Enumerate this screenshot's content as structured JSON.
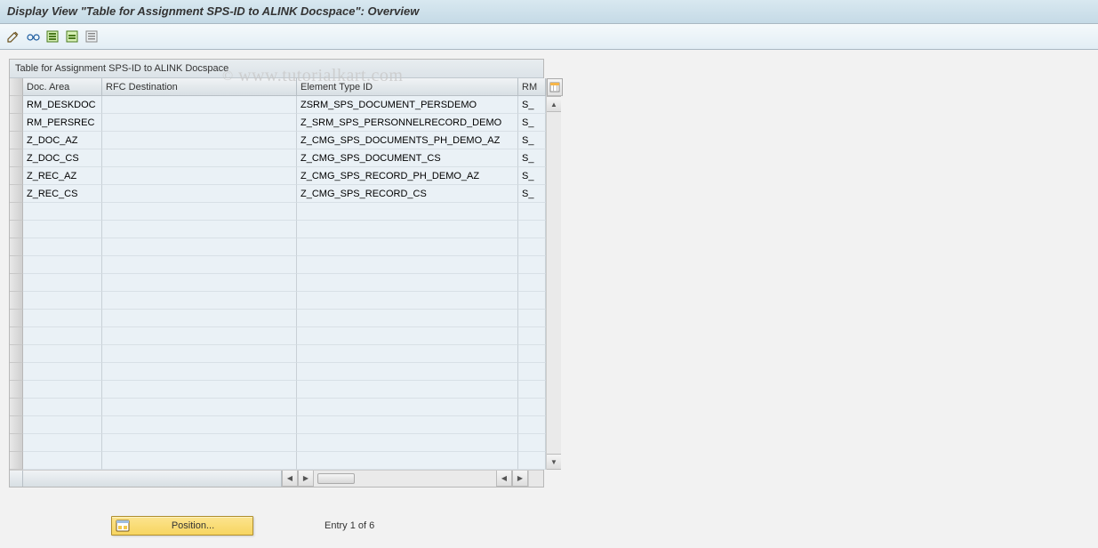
{
  "title": "Display View \"Table for Assignment SPS-ID to ALINK Docspace\": Overview",
  "watermark": "www.tutorialkart.com",
  "table": {
    "title": "Table for Assignment SPS-ID to ALINK Docspace",
    "columns": {
      "doc_area": "Doc. Area",
      "rfc": "RFC Destination",
      "element": "Element Type ID",
      "rm": "RM"
    },
    "rows": [
      {
        "doc_area": "RM_DESKDOC",
        "rfc": "",
        "element": "ZSRM_SPS_DOCUMENT_PERSDEMO",
        "rm": "S_"
      },
      {
        "doc_area": "RM_PERSREC",
        "rfc": "",
        "element": "Z_SRM_SPS_PERSONNELRECORD_DEMO",
        "rm": "S_"
      },
      {
        "doc_area": "Z_DOC_AZ",
        "rfc": "",
        "element": "Z_CMG_SPS_DOCUMENTS_PH_DEMO_AZ",
        "rm": "S_"
      },
      {
        "doc_area": "Z_DOC_CS",
        "rfc": "",
        "element": "Z_CMG_SPS_DOCUMENT_CS",
        "rm": "S_"
      },
      {
        "doc_area": "Z_REC_AZ",
        "rfc": "",
        "element": "Z_CMG_SPS_RECORD_PH_DEMO_AZ",
        "rm": "S_"
      },
      {
        "doc_area": "Z_REC_CS",
        "rfc": "",
        "element": "Z_CMG_SPS_RECORD_CS",
        "rm": "S_"
      }
    ]
  },
  "footer": {
    "position_label": "Position...",
    "entry_text": "Entry 1 of 6"
  }
}
